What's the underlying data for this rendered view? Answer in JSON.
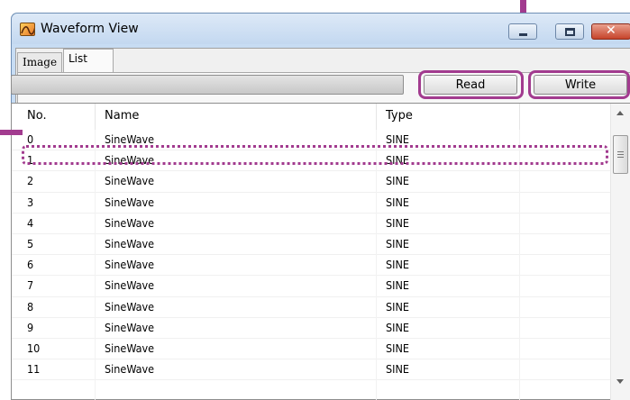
{
  "window": {
    "title": "Waveform View",
    "icon": "waveform-app-icon"
  },
  "tabs": [
    {
      "label": "Image",
      "active": false
    },
    {
      "label": "List",
      "active": true
    }
  ],
  "toolbar": {
    "read_label": "Read",
    "write_label": "Write"
  },
  "list": {
    "columns": [
      "No.",
      "Name",
      "Type"
    ],
    "rows": [
      {
        "no": "0",
        "name": "SineWave",
        "type": "SINE"
      },
      {
        "no": "1",
        "name": "SineWave",
        "type": "SINE"
      },
      {
        "no": "2",
        "name": "SineWave",
        "type": "SINE"
      },
      {
        "no": "3",
        "name": "SineWave",
        "type": "SINE"
      },
      {
        "no": "4",
        "name": "SineWave",
        "type": "SINE"
      },
      {
        "no": "5",
        "name": "SineWave",
        "type": "SINE"
      },
      {
        "no": "6",
        "name": "SineWave",
        "type": "SINE"
      },
      {
        "no": "7",
        "name": "SineWave",
        "type": "SINE"
      },
      {
        "no": "8",
        "name": "SineWave",
        "type": "SINE"
      },
      {
        "no": "9",
        "name": "SineWave",
        "type": "SINE"
      },
      {
        "no": "10",
        "name": "SineWave",
        "type": "SINE"
      },
      {
        "no": "11",
        "name": "SineWave",
        "type": "SINE"
      }
    ]
  },
  "colors": {
    "annotation": "#a23b8f"
  }
}
